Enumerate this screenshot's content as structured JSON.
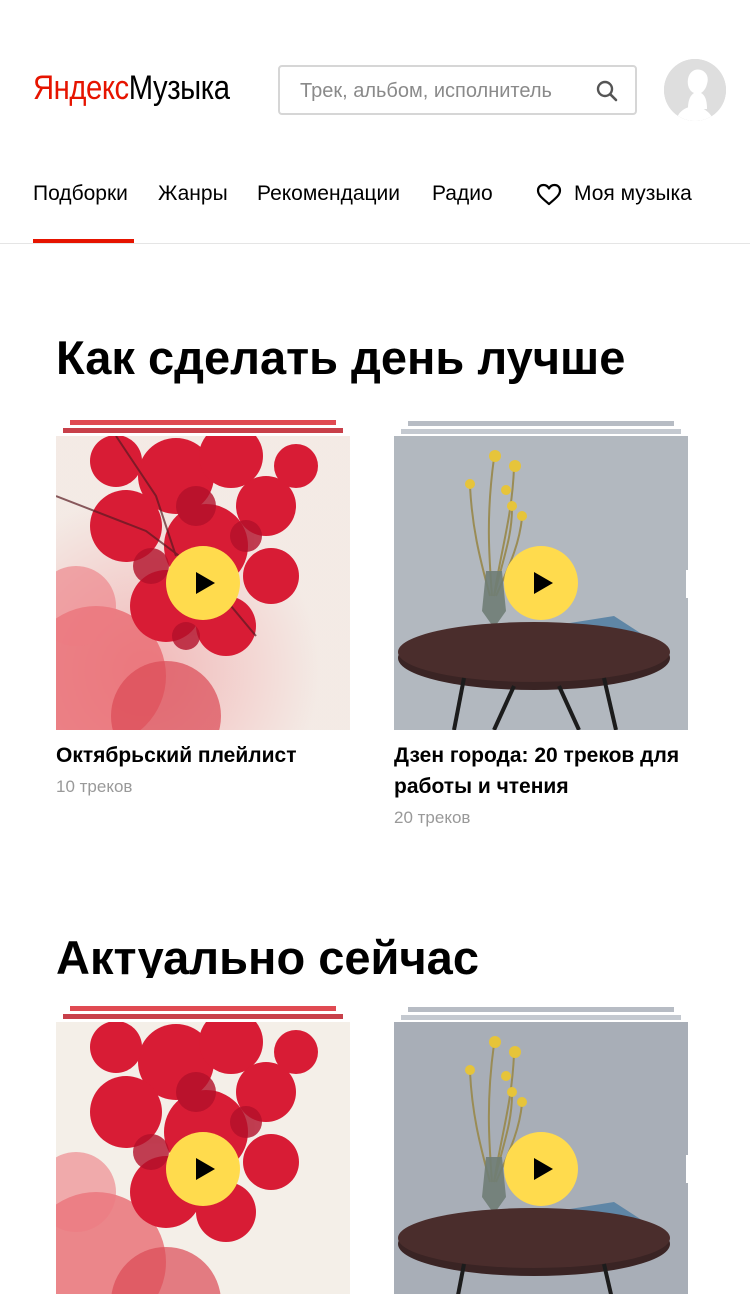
{
  "header": {
    "logo_yandex": "Яндекс",
    "logo_music": "Музыка",
    "search_placeholder": "Трек, альбом, исполнитель"
  },
  "nav": {
    "items": [
      "Подборки",
      "Жанры",
      "Рекомендации",
      "Радио"
    ],
    "my_music": "Моя музыка",
    "active": "Подборки"
  },
  "sections": [
    {
      "title": "Как сделать день лучше",
      "cards": [
        {
          "title": "Октябрьский плейлист",
          "subtitle": "10 треков"
        },
        {
          "title": "Дзен города: 20 треков для работы и чтения",
          "subtitle": "20 треков"
        }
      ]
    },
    {
      "title": "Актуально сейчас",
      "cards": [
        {
          "title": "",
          "subtitle": ""
        },
        {
          "title": "",
          "subtitle": ""
        }
      ]
    }
  ],
  "colors": {
    "brand_red": "#e61400",
    "play_yellow": "#ffdb4d",
    "muted_text": "#999999"
  },
  "icons": [
    "search-icon",
    "avatar-icon",
    "heart-icon",
    "play-icon"
  ]
}
